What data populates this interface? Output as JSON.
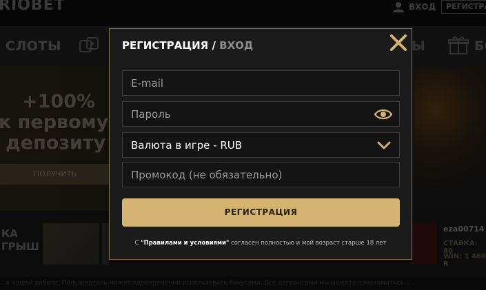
{
  "site": {
    "logo": "RIOBET",
    "login_label": "ВХОД",
    "register_label": "РЕГИСТРАЦИ",
    "nav": {
      "slots": "СЛОТЫ",
      "right_fragment": "Ы",
      "right_cut": "БО"
    },
    "hero": {
      "line1": "+100%",
      "line2": "к первому",
      "line3": "депозиту",
      "button": "ПОЛУЧИТЬ"
    },
    "winners": {
      "label_line1": "КА",
      "label_line2": "ГРЫШ",
      "user": "eza00714",
      "bet": "СТАВКА: 80",
      "win": "WIN: 1 460 R"
    },
    "footer_text": "...в нашей работе. Пользователь может одновременно использовать бонусами. Все депозитами мы можете ознакомиться..."
  },
  "modal": {
    "title_register": "РЕГИСТРАЦИЯ",
    "title_separator": " / ",
    "title_login": "ВХОД",
    "email": {
      "placeholder": "E-mail",
      "value": ""
    },
    "password": {
      "placeholder": "Пароль",
      "value": ""
    },
    "currency": {
      "selected": "Валюта в игре - RUB"
    },
    "promo": {
      "placeholder": "Промокод (не обязательно)",
      "value": ""
    },
    "submit_label": "РЕГИСТРАЦИЯ",
    "terms_prefix": "С ",
    "terms_link": "\"Правилами и условиями\"",
    "terms_suffix": " согласен полностью и мой возраст старше 18 лет"
  },
  "colors": {
    "accent": "#d4b373",
    "modal_border": "#8a7448",
    "close_icon": "#d4b373",
    "field_bg": "#141414"
  },
  "icons": {
    "close": "close-x-icon",
    "password_toggle": "eye-icon",
    "dropdown": "chevron-down-icon",
    "user": "user-icon",
    "gift": "gift-icon"
  }
}
